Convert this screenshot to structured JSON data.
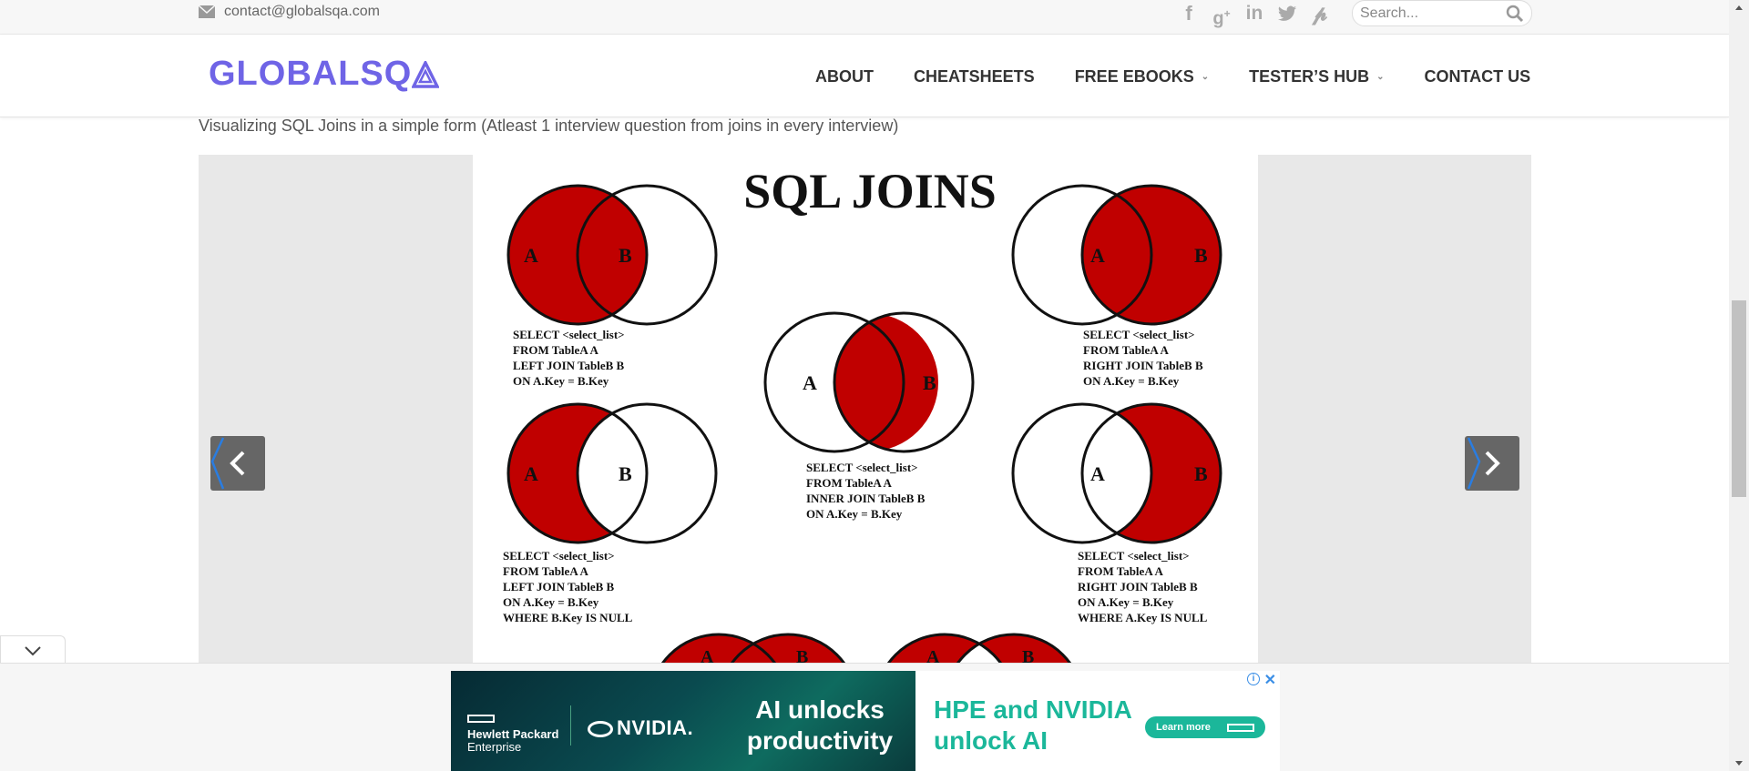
{
  "topbar": {
    "email": "contact@globalsqa.com",
    "social_icons": [
      "facebook-icon",
      "google-plus-icon",
      "linkedin-icon",
      "twitter-icon",
      "pinterest-icon"
    ],
    "search_placeholder": "Search..."
  },
  "header": {
    "logo_text": "GLOBALSQ",
    "nav": [
      {
        "label": "ABOUT",
        "has_dropdown": false
      },
      {
        "label": "CHEATSHEETS",
        "has_dropdown": false
      },
      {
        "label": "FREE EBOOKS",
        "has_dropdown": true
      },
      {
        "label": "TESTER’S HUB",
        "has_dropdown": true
      },
      {
        "label": "CONTACT US",
        "has_dropdown": false
      }
    ]
  },
  "content": {
    "subtitle": "Visualizing SQL Joins in a simple form (Atleast 1 interview question from joins in every interview)",
    "slide": {
      "title": "SQL JOINS",
      "set_a": "A",
      "set_b": "B",
      "queries": {
        "left_join": [
          "SELECT <select_list>",
          "FROM TableA A",
          "LEFT JOIN TableB B",
          "ON A.Key = B.Key"
        ],
        "right_join": [
          "SELECT <select_list>",
          "FROM TableA A",
          "RIGHT JOIN TableB B",
          "ON A.Key = B.Key"
        ],
        "inner_join": [
          "SELECT <select_list>",
          "FROM TableA A",
          "INNER JOIN TableB B",
          "ON A.Key = B.Key"
        ],
        "left_excl": [
          "SELECT <select_list>",
          "FROM TableA A",
          "LEFT JOIN TableB B",
          "ON A.Key = B.Key",
          "WHERE B.Key IS NULL"
        ],
        "right_excl": [
          "SELECT <select_list>",
          "FROM TableA A",
          "RIGHT JOIN TableB B",
          "ON A.Key = B.Key",
          "WHERE A.Key IS NULL"
        ]
      }
    }
  },
  "ad": {
    "hpe": [
      "Hewlett Packard",
      "Enterprise"
    ],
    "nvidia": "NVIDIA.",
    "headline": "AI unlocks productivity",
    "right_headline": "HPE and NVIDIA unlock AI",
    "cta": "Learn more"
  },
  "colors": {
    "brand": "#6f64e6",
    "venn_fill": "#c00000",
    "ad_green": "#1bb79a"
  }
}
